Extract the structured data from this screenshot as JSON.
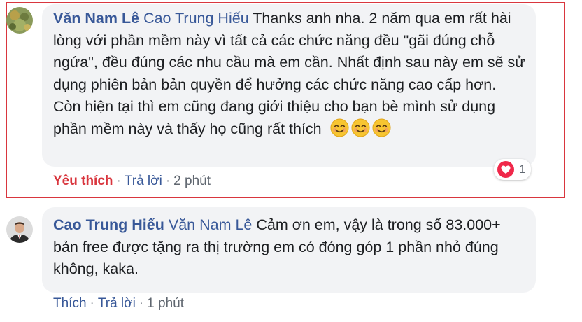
{
  "comments": [
    {
      "author": "Văn Nam Lê",
      "mention": "Cao Trung Hiếu",
      "text": "Thanks anh nha. 2 năm qua em rất hài lòng với phần mềm này vì tất cả các chức năng đều \"gãi đúng chỗ ngứa\", đều đúng các nhu cầu mà em cần. Nhất định sau này em sẽ sử dụng phiên bản bản quyền để hưởng các chức năng cao cấp hơn. Còn hiện tại thì em cũng đang giới thiệu cho bạn bè mình sử dụng phần mềm này và thấy họ cũng rất thích",
      "emoji_icon": "smiling-face-emoji",
      "like_label": "Yêu thích",
      "reply_label": "Trả lời",
      "time": "2 phút",
      "reaction_icon": "heart-icon",
      "reaction_count": "1"
    },
    {
      "author": "Cao Trung Hiếu",
      "mention": "Văn Nam Lê",
      "text": "Cảm ơn em, vậy là trong số 83.000+ bản free được tặng ra thị trường em có đóng góp 1 phần nhỏ đúng không, kaka.",
      "like_label": "Thích",
      "reply_label": "Trả lời",
      "time": "1 phút"
    }
  ],
  "colors": {
    "name": "#385898",
    "bubble": "#f2f3f5",
    "liked": "#d9363e",
    "meta": "#606770",
    "highlight_border": "#d9363e"
  }
}
